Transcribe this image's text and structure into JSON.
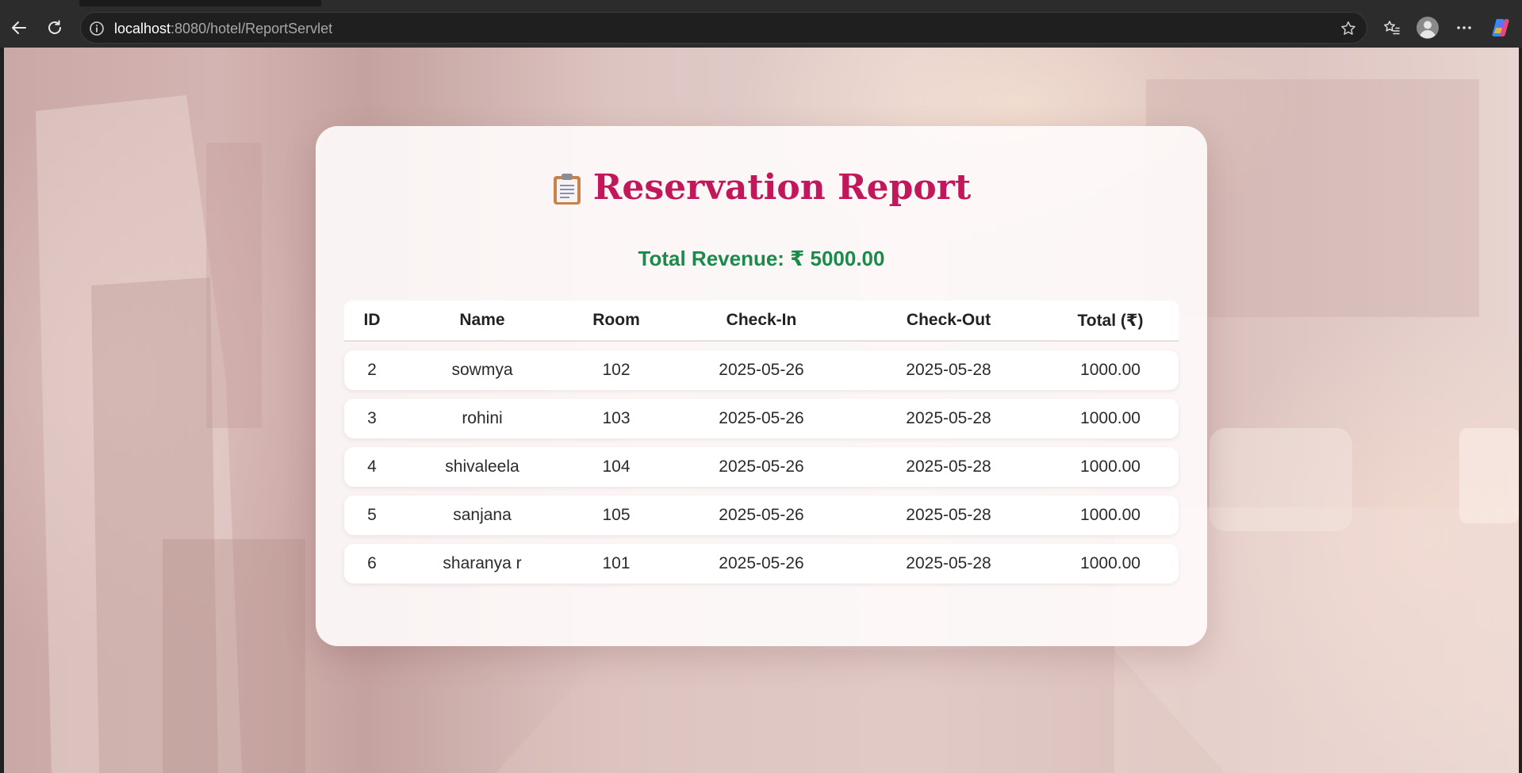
{
  "browser": {
    "url_host": "localhost",
    "url_path": ":8080/hotel/ReportServlet"
  },
  "page": {
    "title": "Reservation Report",
    "title_icon": "clipboard-icon",
    "revenue": "Total Revenue: ₹ 5000.00",
    "accent_color": "#c2185b",
    "revenue_color": "#1b8a4a"
  },
  "table": {
    "headers": {
      "id": "ID",
      "name": "Name",
      "room": "Room",
      "checkin": "Check-In",
      "checkout": "Check-Out",
      "total": "Total (₹)"
    },
    "rows": [
      {
        "id": "2",
        "name": "sowmya",
        "room": "102",
        "checkin": "2025-05-26",
        "checkout": "2025-05-28",
        "total": "1000.00"
      },
      {
        "id": "3",
        "name": "rohini",
        "room": "103",
        "checkin": "2025-05-26",
        "checkout": "2025-05-28",
        "total": "1000.00"
      },
      {
        "id": "4",
        "name": "shivaleela",
        "room": "104",
        "checkin": "2025-05-26",
        "checkout": "2025-05-28",
        "total": "1000.00"
      },
      {
        "id": "5",
        "name": "sanjana",
        "room": "105",
        "checkin": "2025-05-26",
        "checkout": "2025-05-28",
        "total": "1000.00"
      },
      {
        "id": "6",
        "name": "sharanya r",
        "room": "101",
        "checkin": "2025-05-26",
        "checkout": "2025-05-28",
        "total": "1000.00"
      }
    ]
  }
}
